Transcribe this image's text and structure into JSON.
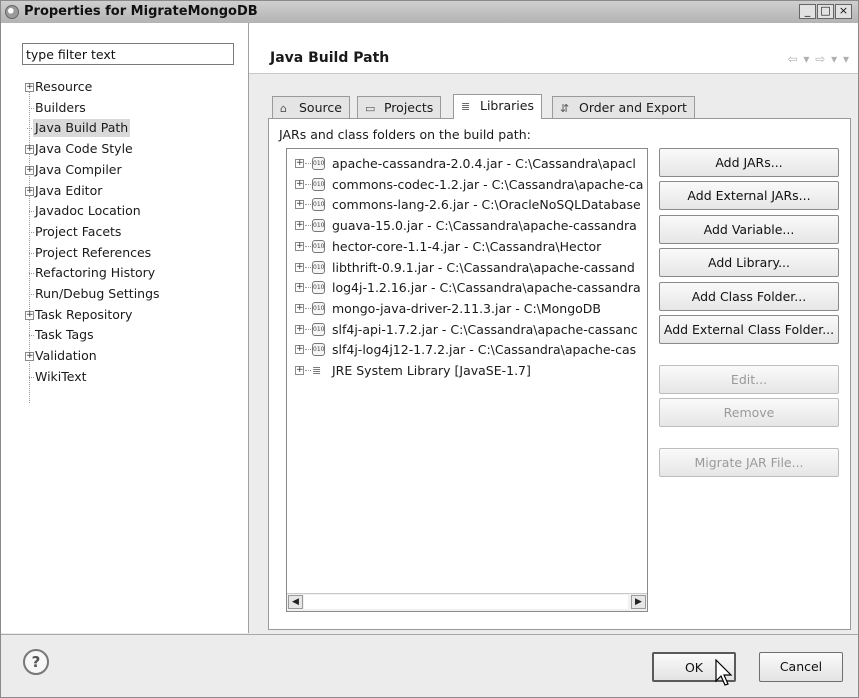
{
  "window": {
    "title": "Properties for MigrateMongoDB",
    "controls": [
      "_",
      "□",
      "×"
    ]
  },
  "sidebar": {
    "filter_placeholder": "type filter text",
    "items": [
      {
        "label": "Resource",
        "expandable": true
      },
      {
        "label": "Builders",
        "expandable": false
      },
      {
        "label": "Java Build Path",
        "expandable": false,
        "selected": true
      },
      {
        "label": "Java Code Style",
        "expandable": true
      },
      {
        "label": "Java Compiler",
        "expandable": true
      },
      {
        "label": "Java Editor",
        "expandable": true
      },
      {
        "label": "Javadoc Location",
        "expandable": false
      },
      {
        "label": "Project Facets",
        "expandable": false
      },
      {
        "label": "Project References",
        "expandable": false
      },
      {
        "label": "Refactoring History",
        "expandable": false
      },
      {
        "label": "Run/Debug Settings",
        "expandable": false
      },
      {
        "label": "Task Repository",
        "expandable": true
      },
      {
        "label": "Task Tags",
        "expandable": false
      },
      {
        "label": "Validation",
        "expandable": true
      },
      {
        "label": "WikiText",
        "expandable": false
      }
    ]
  },
  "main": {
    "title": "Java Build Path",
    "nav": "⇦ ▾ ⇨ ▾ ▾",
    "tabs": [
      {
        "label": "Source",
        "icon": "source-folder-icon",
        "glyph": "⌂"
      },
      {
        "label": "Projects",
        "icon": "projects-icon",
        "glyph": "▭"
      },
      {
        "label": "Libraries",
        "icon": "libraries-icon",
        "glyph": "≣",
        "active": true
      },
      {
        "label": "Order and Export",
        "icon": "order-export-icon",
        "glyph": "⇵"
      }
    ],
    "panel_label": "JARs and class folders on the build path:",
    "libraries": [
      "apache-cassandra-2.0.4.jar - C:\\Cassandra\\apacl",
      "commons-codec-1.2.jar - C:\\Cassandra\\apache-ca",
      "commons-lang-2.6.jar - C:\\OracleNoSQLDatabase",
      "guava-15.0.jar - C:\\Cassandra\\apache-cassandra",
      "hector-core-1.1-4.jar - C:\\Cassandra\\Hector",
      "libthrift-0.9.1.jar - C:\\Cassandra\\apache-cassand",
      "log4j-1.2.16.jar - C:\\Cassandra\\apache-cassandra",
      "mongo-java-driver-2.11.3.jar - C:\\MongoDB",
      "slf4j-api-1.7.2.jar - C:\\Cassandra\\apache-cassanc",
      "slf4j-log4j12-1.7.2.jar - C:\\Cassandra\\apache-cas",
      "JRE System Library [JavaSE-1.7]"
    ],
    "jar_icon_text": "010",
    "buttons": {
      "add_jars": "Add JARs...",
      "add_external_jars": "Add External JARs...",
      "add_variable": "Add Variable...",
      "add_library": "Add Library...",
      "add_class_folder": "Add Class Folder...",
      "add_external_class_folder": "Add External Class Folder...",
      "edit": "Edit...",
      "remove": "Remove",
      "migrate_jar": "Migrate JAR File..."
    }
  },
  "footer": {
    "help": "?",
    "ok": "OK",
    "cancel": "Cancel"
  }
}
